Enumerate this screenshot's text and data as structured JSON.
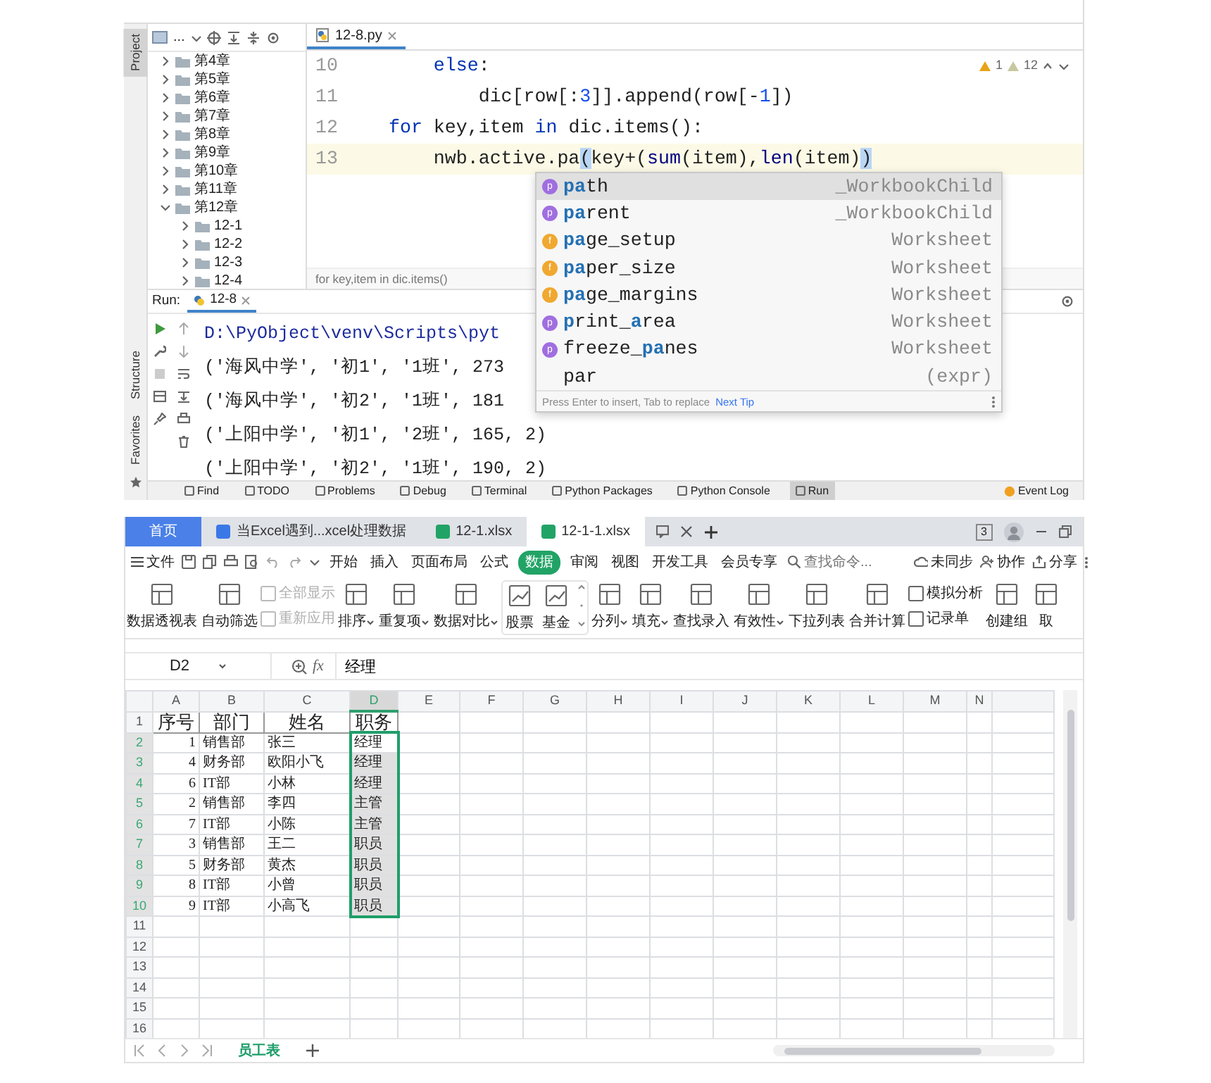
{
  "ide": {
    "side_tabs": [
      {
        "label": "Project",
        "selected": true
      },
      {
        "label": "Structure",
        "selected": false
      },
      {
        "label": "Favorites",
        "selected": false
      }
    ],
    "project_view": "...",
    "project_tree": [
      {
        "label": "第4章",
        "expanded": false
      },
      {
        "label": "第5章",
        "expanded": false
      },
      {
        "label": "第6章",
        "expanded": false
      },
      {
        "label": "第7章",
        "expanded": false
      },
      {
        "label": "第8章",
        "expanded": false
      },
      {
        "label": "第9章",
        "expanded": false
      },
      {
        "label": "第10章",
        "expanded": false
      },
      {
        "label": "第11章",
        "expanded": false
      },
      {
        "label": "第12章",
        "expanded": true,
        "children": [
          {
            "label": "12-1",
            "expanded": false
          },
          {
            "label": "12-2",
            "expanded": false
          },
          {
            "label": "12-3",
            "expanded": false
          },
          {
            "label": "12-4",
            "expanded": false
          }
        ]
      }
    ],
    "editor_tab": "12-8.py",
    "code_lines": [
      {
        "number": "10",
        "current": false,
        "tokens": [
          {
            "text": "    else",
            "kind": "keyword"
          },
          {
            "text": ":",
            "kind": "plain"
          }
        ]
      },
      {
        "number": "11",
        "current": false,
        "tokens": [
          {
            "text": "        dic[row[:",
            "kind": "plain"
          },
          {
            "text": "3",
            "kind": "number"
          },
          {
            "text": "]].append(row[-",
            "kind": "plain"
          },
          {
            "text": "1",
            "kind": "number"
          },
          {
            "text": "])",
            "kind": "plain"
          }
        ]
      },
      {
        "number": "12",
        "current": false,
        "tokens": [
          {
            "text": "for",
            "kind": "keyword"
          },
          {
            "text": " key,item ",
            "kind": "plain"
          },
          {
            "text": "in",
            "kind": "keyword"
          },
          {
            "text": " dic.items():",
            "kind": "plain"
          }
        ]
      },
      {
        "number": "13",
        "current": true,
        "tokens": [
          {
            "text": "    nwb.active.pa",
            "kind": "plain"
          },
          {
            "text": "(",
            "kind": "bracket"
          },
          {
            "text": "key+(",
            "kind": "plain"
          },
          {
            "text": "sum",
            "kind": "builtin"
          },
          {
            "text": "(item),",
            "kind": "plain"
          },
          {
            "text": "len",
            "kind": "builtin"
          },
          {
            "text": "(item)",
            "kind": "plain"
          },
          {
            "text": ")",
            "kind": "bracket"
          }
        ]
      }
    ],
    "inspections": [
      {
        "count": "1",
        "kind": "warning"
      },
      {
        "count": "12",
        "kind": "weak"
      }
    ],
    "breadcrumb": "for key,item in dic.items()",
    "completion": {
      "items": [
        {
          "badge": "p",
          "kind": "property",
          "name": "**pa**th",
          "type": "_WorkbookChild",
          "selected": true
        },
        {
          "badge": "p",
          "kind": "property",
          "name": "**pa**rent",
          "type": "_WorkbookChild",
          "selected": false
        },
        {
          "badge": "f",
          "kind": "field",
          "name": "**pa**ge_setup",
          "type": "Worksheet",
          "selected": false
        },
        {
          "badge": "f",
          "kind": "field",
          "name": "**pa**per_size",
          "type": "Worksheet",
          "selected": false
        },
        {
          "badge": "f",
          "kind": "field",
          "name": "**pa**ge_margins",
          "type": "Worksheet",
          "selected": false
        },
        {
          "badge": "p",
          "kind": "property",
          "name": "**p**rint_**a**rea",
          "type": "Worksheet",
          "selected": false
        },
        {
          "badge": "p",
          "kind": "property",
          "name": "freeze_**pa**nes",
          "type": "Worksheet",
          "selected": false
        },
        {
          "kind": "template",
          "name": "par",
          "type": "(expr)",
          "selected": false
        }
      ],
      "hint": "Press Enter to insert, Tab to replace",
      "tip_link": "Next Tip"
    },
    "run": {
      "label": "Run:",
      "tab": "12-8",
      "output": [
        {
          "kind": "command",
          "text": "D:\\PyObject\\venv\\Scripts\\pyt"
        },
        {
          "kind": "result",
          "text": "('海风中学', '初1', '1班', 273"
        },
        {
          "kind": "result",
          "text": "('海风中学', '初2', '1班', 181"
        },
        {
          "kind": "result",
          "text": "('上阳中学', '初1', '2班', 165, 2)"
        },
        {
          "kind": "result",
          "text": "('上阳中学', '初2', '1班', 190, 2)"
        }
      ]
    },
    "tool_windows": [
      {
        "label": "Find",
        "selected": false
      },
      {
        "label": "TODO",
        "selected": false
      },
      {
        "label": "Problems",
        "selected": false
      },
      {
        "label": "Debug",
        "selected": false
      },
      {
        "label": "Terminal",
        "selected": false
      },
      {
        "label": "Python Packages",
        "selected": false
      },
      {
        "label": "Python Console",
        "selected": false
      },
      {
        "label": "Run",
        "selected": true
      }
    ],
    "event_log": "Event Log"
  },
  "wps": {
    "tabs": [
      {
        "label": "首页",
        "kind": "home",
        "selected": false
      },
      {
        "label": "当Excel遇到...xcel处理数据",
        "kind": "document",
        "selected": false
      },
      {
        "label": "12-1.xlsx",
        "kind": "spreadsheet",
        "selected": false
      },
      {
        "label": "12-1-1.xlsx",
        "kind": "spreadsheet",
        "selected": true
      }
    ],
    "window_count": "3",
    "file_menu": "文件",
    "menu": [
      {
        "label": "开始",
        "selected": false
      },
      {
        "label": "插入",
        "selected": false
      },
      {
        "label": "页面布局",
        "selected": false
      },
      {
        "label": "公式",
        "selected": false
      },
      {
        "label": "数据",
        "selected": true
      },
      {
        "label": "审阅",
        "selected": false
      },
      {
        "label": "视图",
        "selected": false
      },
      {
        "label": "开发工具",
        "selected": false
      },
      {
        "label": "会员专享",
        "selected": false
      }
    ],
    "search_placeholder": "查找命令...",
    "actions": [
      "未同步",
      "协作",
      "分享"
    ],
    "ribbon": [
      {
        "kind": "large",
        "label": "数据透视表",
        "dropdown": false
      },
      {
        "kind": "large",
        "label": "自动筛选",
        "dropdown": false
      },
      {
        "kind": "stack",
        "items": [
          {
            "label": "全部显示",
            "disabled": true
          },
          {
            "label": "重新应用",
            "disabled": true
          }
        ]
      },
      {
        "kind": "large",
        "label": "排序",
        "dropdown": true
      },
      {
        "kind": "large",
        "label": "重复项",
        "dropdown": true
      },
      {
        "kind": "large",
        "label": "数据对比",
        "dropdown": true
      },
      {
        "kind": "gallery",
        "items": [
          "股票",
          "基金"
        ]
      },
      {
        "kind": "large",
        "label": "分列",
        "dropdown": true
      },
      {
        "kind": "large",
        "label": "填充",
        "dropdown": true
      },
      {
        "kind": "large",
        "label": "查找录入",
        "dropdown": false
      },
      {
        "kind": "large",
        "label": "有效性",
        "dropdown": true
      },
      {
        "kind": "large",
        "label": "下拉列表",
        "dropdown": false
      },
      {
        "kind": "large",
        "label": "合并计算",
        "dropdown": false
      },
      {
        "kind": "stack",
        "items": [
          {
            "label": "模拟分析",
            "disabled": false
          },
          {
            "label": "记录单",
            "disabled": false
          }
        ]
      },
      {
        "kind": "large",
        "label": "创建组",
        "dropdown": false
      },
      {
        "kind": "large",
        "label": "取",
        "dropdown": false
      }
    ],
    "name_box": "D2",
    "fx": "fx",
    "formula": "经理",
    "columns": [
      {
        "label": "A",
        "selected": false
      },
      {
        "label": "B",
        "selected": false
      },
      {
        "label": "C",
        "selected": false
      },
      {
        "label": "D",
        "selected": true
      },
      {
        "label": "E",
        "selected": false
      },
      {
        "label": "F",
        "selected": false
      },
      {
        "label": "G",
        "selected": false
      },
      {
        "label": "H",
        "selected": false
      },
      {
        "label": "I",
        "selected": false
      },
      {
        "label": "J",
        "selected": false
      },
      {
        "label": "K",
        "selected": false
      },
      {
        "label": "L",
        "selected": false
      },
      {
        "label": "M",
        "selected": false
      },
      {
        "label": "N",
        "selected": false
      }
    ],
    "rows": [
      {
        "number": "1",
        "kind": "header",
        "selected": false,
        "active": false,
        "cells": [
          "序号",
          "部门",
          "姓名",
          "职务"
        ]
      },
      {
        "number": "2",
        "kind": "data",
        "selected": true,
        "active": true,
        "cells": [
          "1",
          "销售部",
          "张三",
          "经理"
        ]
      },
      {
        "number": "3",
        "kind": "data",
        "selected": true,
        "active": false,
        "cells": [
          "4",
          "财务部",
          "欧阳小飞",
          "经理"
        ]
      },
      {
        "number": "4",
        "kind": "data",
        "selected": true,
        "active": false,
        "cells": [
          "6",
          "IT部",
          "小林",
          "经理"
        ]
      },
      {
        "number": "5",
        "kind": "data",
        "selected": true,
        "active": false,
        "cells": [
          "2",
          "销售部",
          "李四",
          "主管"
        ]
      },
      {
        "number": "6",
        "kind": "data",
        "selected": true,
        "active": false,
        "cells": [
          "7",
          "IT部",
          "小陈",
          "主管"
        ]
      },
      {
        "number": "7",
        "kind": "data",
        "selected": true,
        "active": false,
        "cells": [
          "3",
          "销售部",
          "王二",
          "职员"
        ]
      },
      {
        "number": "8",
        "kind": "data",
        "selected": true,
        "active": false,
        "cells": [
          "5",
          "财务部",
          "黄杰",
          "职员"
        ]
      },
      {
        "number": "9",
        "kind": "data",
        "selected": true,
        "active": false,
        "cells": [
          "8",
          "IT部",
          "小曾",
          "职员"
        ]
      },
      {
        "number": "10",
        "kind": "data",
        "selected": true,
        "active": false,
        "cells": [
          "9",
          "IT部",
          "小高飞",
          "职员"
        ]
      },
      {
        "number": "11",
        "kind": "data",
        "selected": false,
        "active": false
      },
      {
        "number": "12",
        "kind": "data",
        "selected": false,
        "active": false
      },
      {
        "number": "13",
        "kind": "data",
        "selected": false,
        "active": false
      },
      {
        "number": "14",
        "kind": "data",
        "selected": false,
        "active": false
      },
      {
        "number": "15",
        "kind": "data",
        "selected": false,
        "active": false
      },
      {
        "number": "16",
        "kind": "data",
        "selected": false,
        "active": false
      }
    ],
    "sheet_tabs": [
      {
        "label": "员工表",
        "selected": true
      }
    ]
  }
}
